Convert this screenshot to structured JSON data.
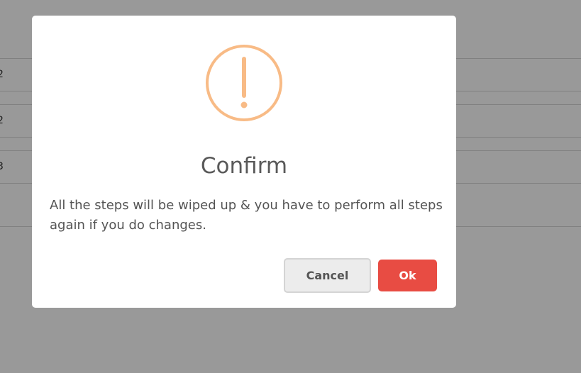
{
  "background_table": {
    "rows": [
      {
        "cell": "2"
      },
      {
        "cell": "2"
      },
      {
        "cell": "3"
      }
    ]
  },
  "dialog": {
    "icon": "exclamation-circle-icon",
    "icon_color": "#f8bb86",
    "title": "Confirm",
    "message": "All the steps will be wiped up & you have to perform all steps again if you do changes.",
    "cancel_label": "Cancel",
    "ok_label": "Ok",
    "ok_color": "#e84c43"
  }
}
